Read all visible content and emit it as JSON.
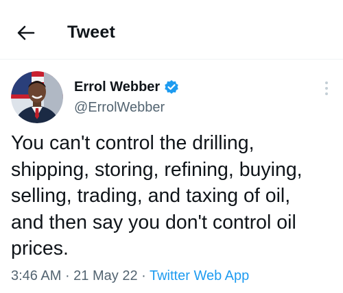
{
  "header": {
    "title": "Tweet",
    "back_icon": "arrow-left-icon"
  },
  "author": {
    "display_name": "Errol Webber",
    "handle": "@ErrolWebber",
    "verified": true,
    "verified_icon": "verified-badge-icon",
    "more_icon": "more-vertical-icon"
  },
  "tweet": {
    "text": "You can't control the drilling,\nshipping, storing, refining, buying,\nselling, trading, and taxing of oil,\nand then say you don't control oil\nprices.",
    "time": "3:46 AM",
    "separator": " · ",
    "date": "21 May 22",
    "source": "Twitter Web App"
  },
  "colors": {
    "text_primary": "#0f1419",
    "text_secondary": "#536471",
    "accent": "#1d9bf0",
    "divider": "#eff3f4"
  }
}
